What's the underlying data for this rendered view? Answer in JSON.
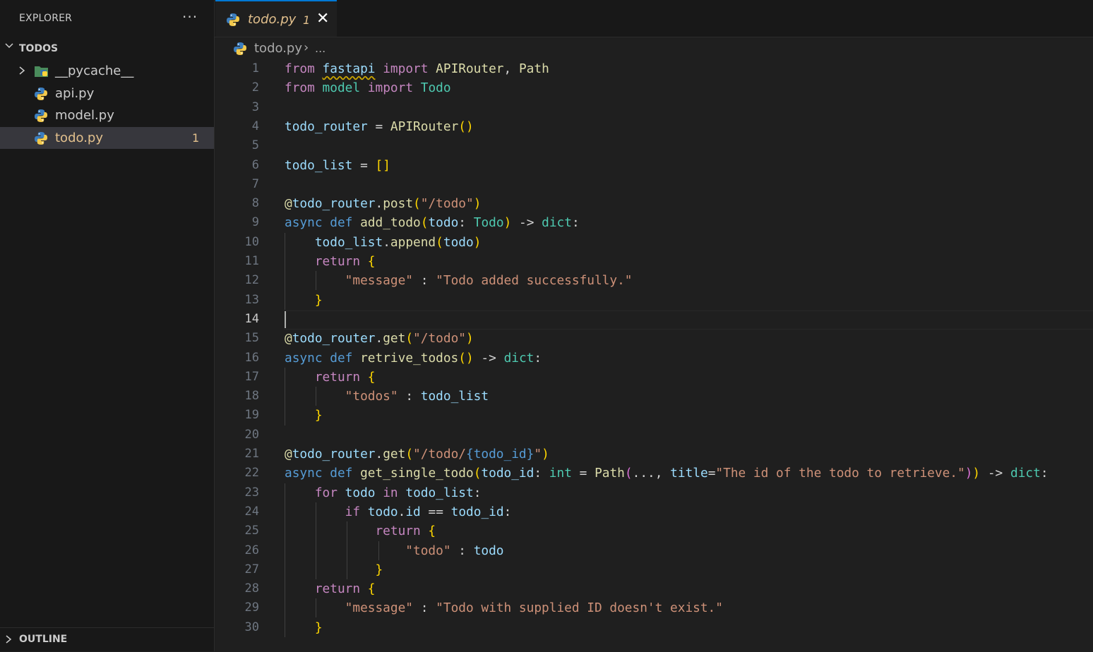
{
  "explorer": {
    "title": "EXPLORER",
    "more_label": "···",
    "folder_name": "TODOS",
    "items": [
      {
        "label": "__pycache__",
        "type": "folder",
        "badge": ""
      },
      {
        "label": "api.py",
        "type": "python",
        "badge": ""
      },
      {
        "label": "model.py",
        "type": "python",
        "badge": ""
      },
      {
        "label": "todo.py",
        "type": "python",
        "badge": "1",
        "active": true
      }
    ],
    "outline_label": "OUTLINE"
  },
  "tab": {
    "label": "todo.py",
    "badge": "1",
    "close": "✕"
  },
  "breadcrumb": {
    "file": "todo.py",
    "separator": "›",
    "more": "..."
  },
  "editor": {
    "active_line": 14,
    "lines": [
      {
        "n": "1",
        "text": "from fastapi import APIRouter, Path"
      },
      {
        "n": "2",
        "text": "from model import Todo"
      },
      {
        "n": "3",
        "text": ""
      },
      {
        "n": "4",
        "text": "todo_router = APIRouter()"
      },
      {
        "n": "5",
        "text": ""
      },
      {
        "n": "6",
        "text": "todo_list = []"
      },
      {
        "n": "7",
        "text": ""
      },
      {
        "n": "8",
        "text": "@todo_router.post(\"/todo\")"
      },
      {
        "n": "9",
        "text": "async def add_todo(todo: Todo) -> dict:"
      },
      {
        "n": "10",
        "text": "    todo_list.append(todo)"
      },
      {
        "n": "11",
        "text": "    return {"
      },
      {
        "n": "12",
        "text": "        \"message\" : \"Todo added successfully.\""
      },
      {
        "n": "13",
        "text": "    }"
      },
      {
        "n": "14",
        "text": ""
      },
      {
        "n": "15",
        "text": "@todo_router.get(\"/todo\")"
      },
      {
        "n": "16",
        "text": "async def retrive_todos() -> dict:"
      },
      {
        "n": "17",
        "text": "    return {"
      },
      {
        "n": "18",
        "text": "        \"todos\" : todo_list"
      },
      {
        "n": "19",
        "text": "    }"
      },
      {
        "n": "20",
        "text": ""
      },
      {
        "n": "21",
        "text": "@todo_router.get(\"/todo/{todo_id}\")"
      },
      {
        "n": "22",
        "text": "async def get_single_todo(todo_id: int = Path(..., title=\"The id of the todo to retrieve.\")) -> dict:"
      },
      {
        "n": "23",
        "text": "    for todo in todo_list:"
      },
      {
        "n": "24",
        "text": "        if todo.id == todo_id:"
      },
      {
        "n": "25",
        "text": "            return {"
      },
      {
        "n": "26",
        "text": "                \"todo\" : todo"
      },
      {
        "n": "27",
        "text": "            }"
      },
      {
        "n": "28",
        "text": "    return {"
      },
      {
        "n": "29",
        "text": "        \"message\" : \"Todo with supplied ID doesn't exist.\""
      },
      {
        "n": "30",
        "text": "    }"
      }
    ]
  },
  "colors": {
    "keyword_import": "#c586c0",
    "keyword_def": "#569cd6",
    "function": "#dcdcaa",
    "variable": "#9cdcfe",
    "type": "#4ec9b0",
    "string": "#ce9178",
    "bracket": "#ffd700",
    "bracket2": "#da70d6",
    "bracket3": "#179fff",
    "modified": "#e2c08d"
  }
}
